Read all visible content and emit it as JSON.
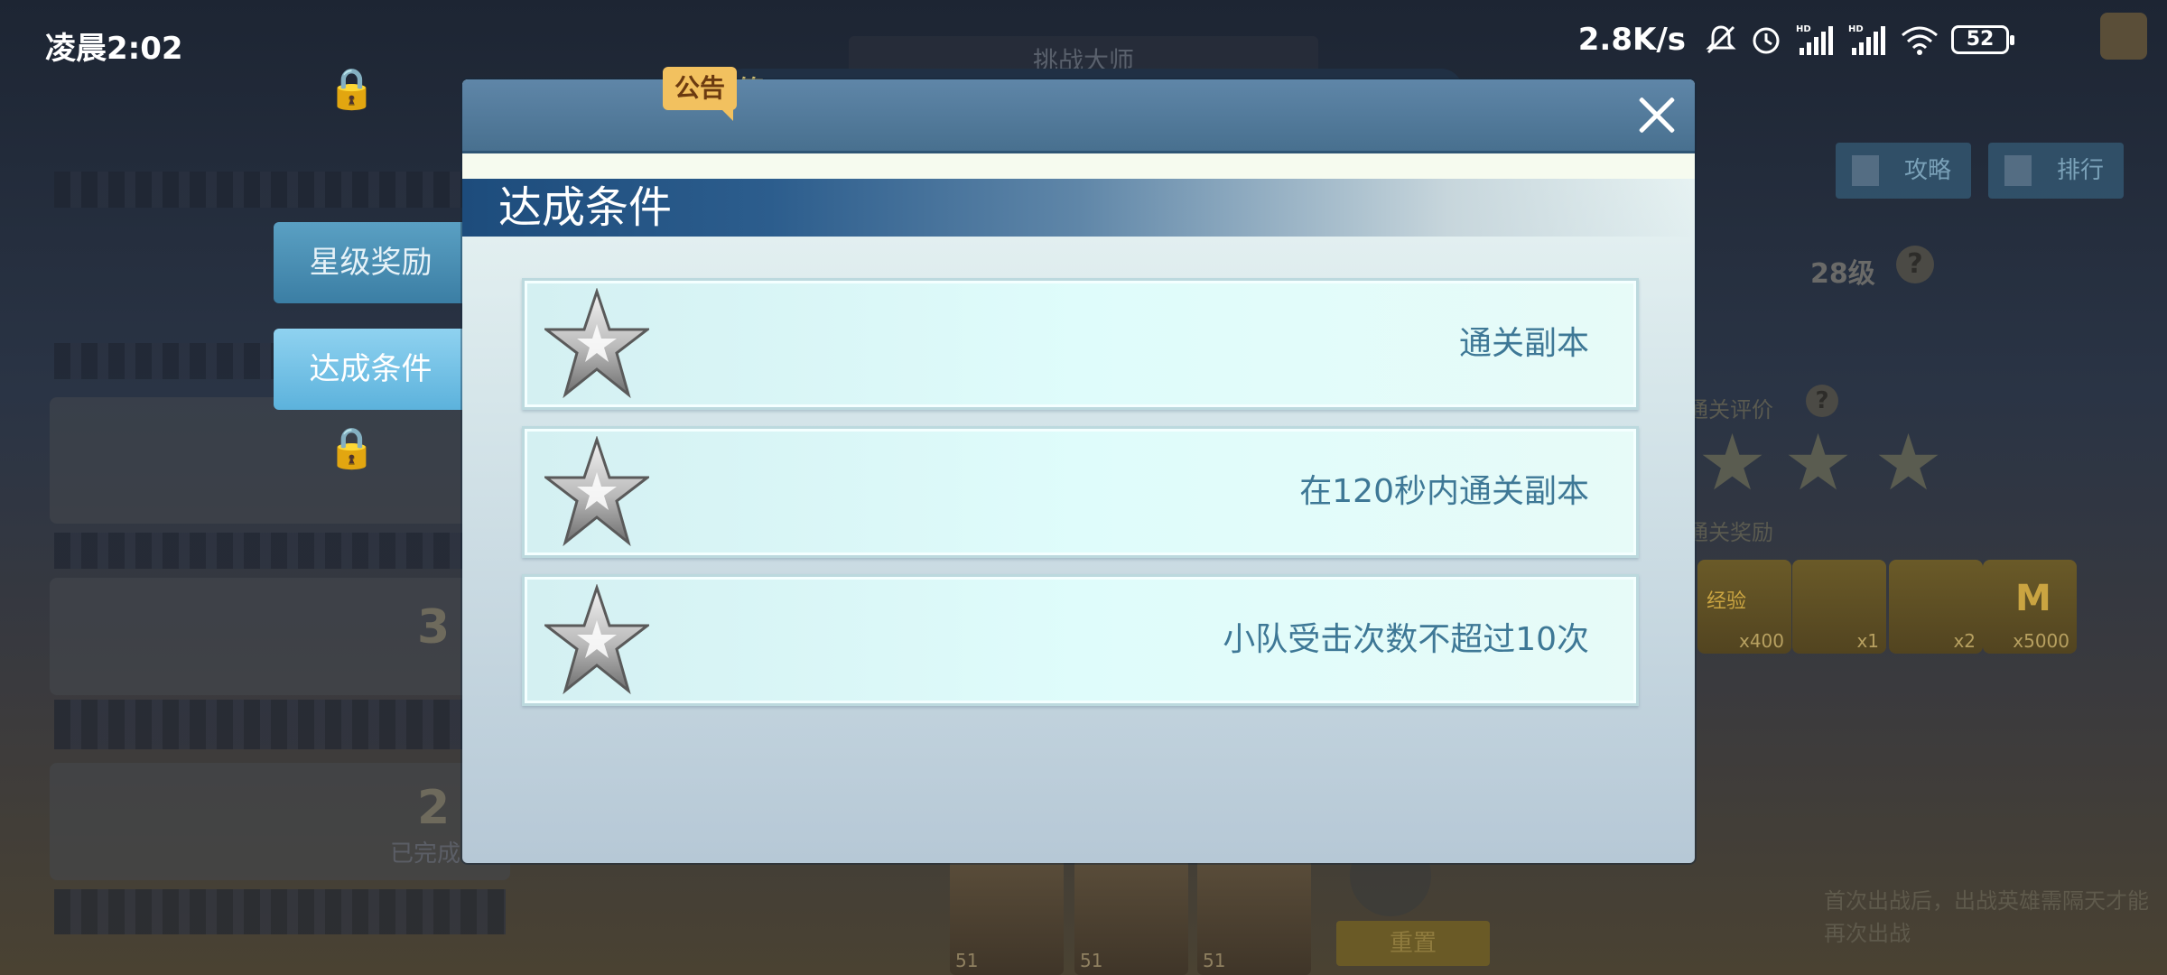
{
  "status_bar": {
    "time": "凌晨2:02",
    "net_speed": "2.8K/s",
    "battery": "52"
  },
  "background": {
    "title": "挑战大师",
    "strategy_label": "攻略",
    "ranking_label": "排行",
    "level": "28级",
    "rating_label": "通关评价",
    "reward_label": "通关奖励",
    "item_counts": [
      "x400",
      "x1",
      "x2",
      "x5000"
    ],
    "item_badge": "经验",
    "item_coin": "M",
    "stage_numbers": [
      "3",
      "2"
    ],
    "stage_status": "已完成",
    "hero_levels": [
      "51",
      "51",
      "51"
    ],
    "reset_label": "重置",
    "note": "首次出战后，出战英雄需隔天才能再次出战"
  },
  "side_tabs": {
    "star_reward": "星级奖励",
    "conditions": "达成条件"
  },
  "announcement": {
    "badge": "公告",
    "text": "签!"
  },
  "dialog": {
    "section_title": "达成条件",
    "conditions": [
      {
        "text": "通关副本"
      },
      {
        "text": "在120秒内通关副本"
      },
      {
        "text": "小队受击次数不超过10次"
      }
    ]
  }
}
